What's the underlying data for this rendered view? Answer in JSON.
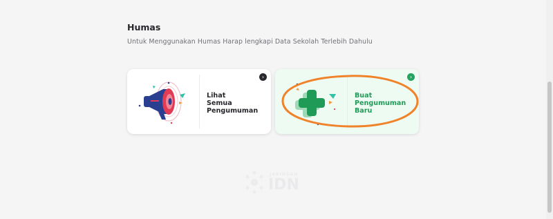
{
  "section": {
    "title": "Humas",
    "subtitle": "Untuk Menggunakan Humas Harap lengkapi Data Sekolah Terlebih Dahulu"
  },
  "cards": [
    {
      "label": "Lihat\nSemua\nPengumuman",
      "icon": "megaphone-icon",
      "arrow": "›"
    },
    {
      "label": "Buat\nPengumuman\nBaru",
      "icon": "plus-icon",
      "arrow": "›"
    }
  ],
  "watermark": {
    "small": "JARINGAN",
    "big": "IDN"
  },
  "colors": {
    "accent_green": "#22a35e",
    "highlight_orange": "#f0822a",
    "megaphone_blue": "#2a3f8f",
    "megaphone_red": "#e23b55"
  }
}
